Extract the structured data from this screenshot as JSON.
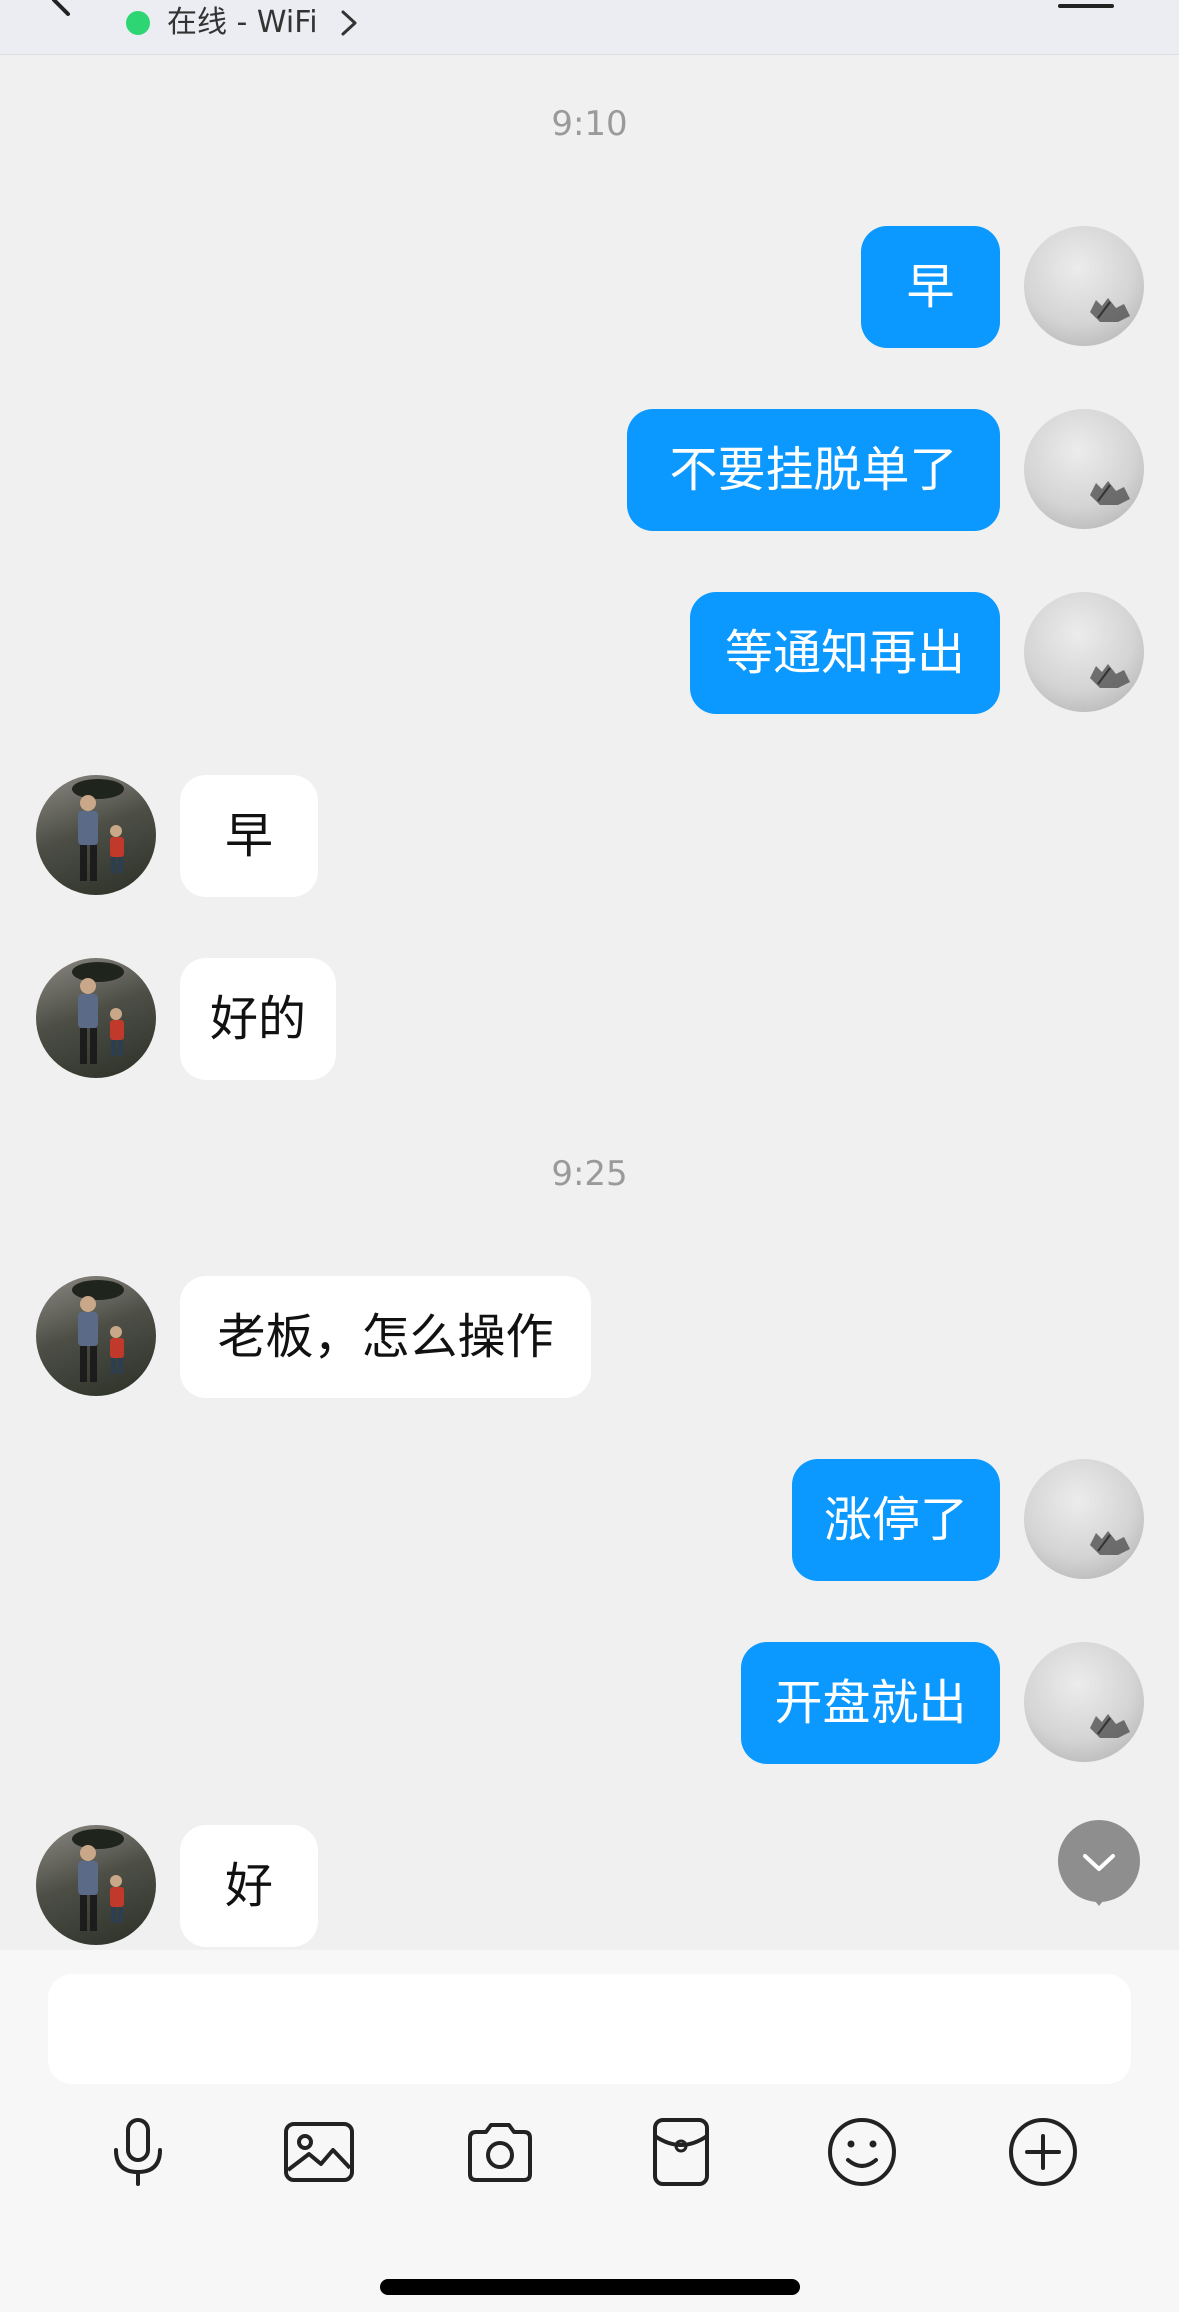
{
  "header": {
    "status_text": "在线 - WiFi"
  },
  "conversation": {
    "timestamps": [
      "9:10",
      "9:25"
    ],
    "messages": [
      {
        "sender": "self",
        "text": "早"
      },
      {
        "sender": "self",
        "text": "不要挂脱单了"
      },
      {
        "sender": "self",
        "text": "等通知再出"
      },
      {
        "sender": "other",
        "text": "早"
      },
      {
        "sender": "other",
        "text": "好的"
      },
      {
        "sender": "other",
        "text": "老板，怎么操作"
      },
      {
        "sender": "self",
        "text": "涨停了"
      },
      {
        "sender": "self",
        "text": "开盘就出"
      },
      {
        "sender": "other",
        "text": "好"
      }
    ]
  },
  "colors": {
    "self_bubble": "#0b99ff",
    "other_bubble": "#ffffff",
    "online_dot": "#2ed573"
  },
  "input": {
    "value": "",
    "placeholder": ""
  },
  "toolbar": {
    "icons": [
      "microphone-icon",
      "image-icon",
      "camera-icon",
      "red-packet-icon",
      "emoji-icon",
      "plus-icon"
    ]
  }
}
